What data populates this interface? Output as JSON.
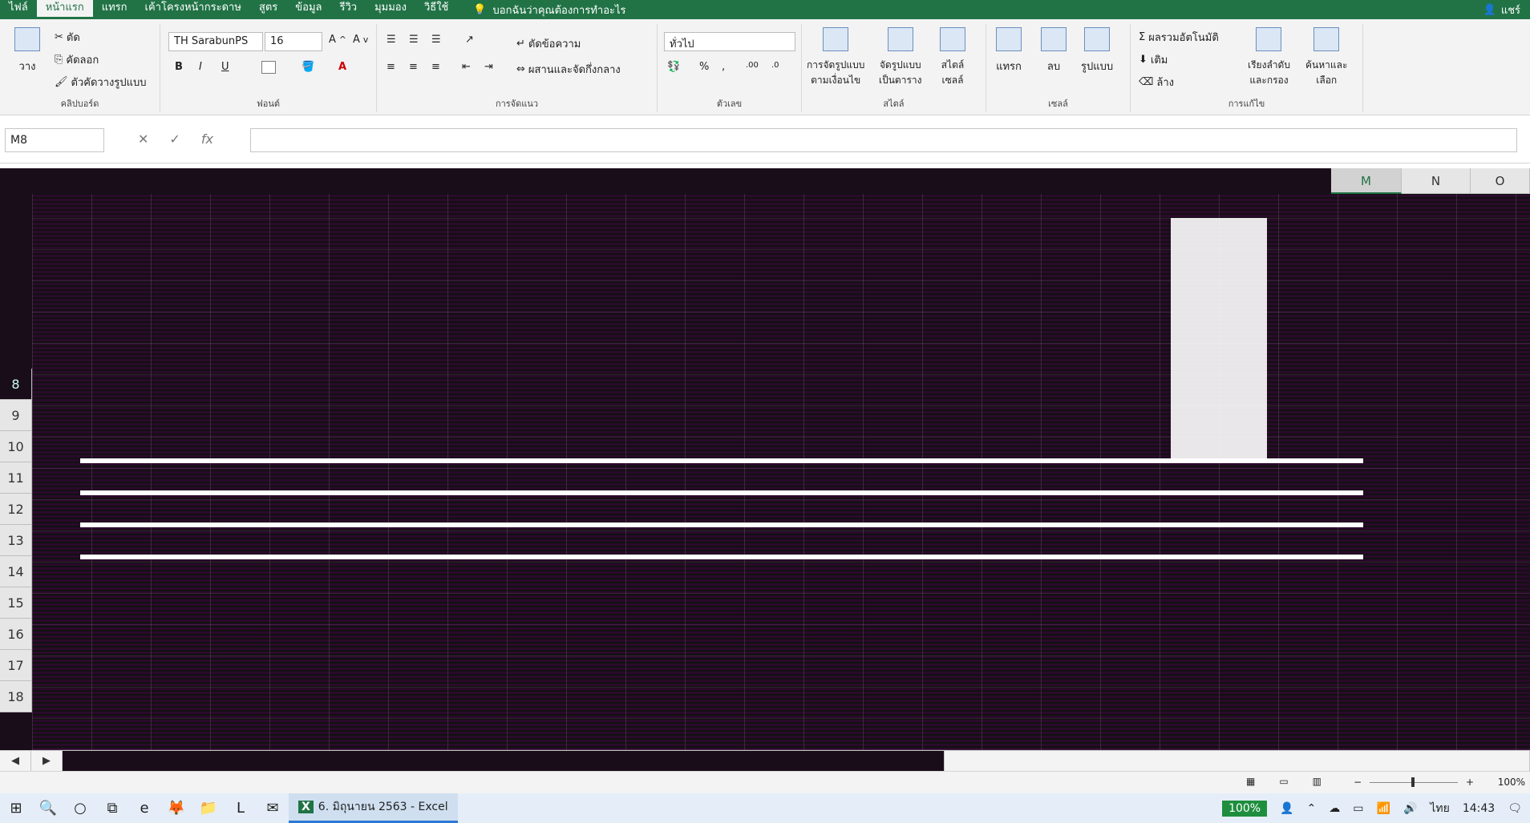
{
  "ribbon_tabs": [
    "ไฟล์",
    "หน้าแรก",
    "แทรก",
    "เค้าโครงหน้ากระดาษ",
    "สูตร",
    "ข้อมูล",
    "รีวิว",
    "มุมมอง",
    "วิธีใช้"
  ],
  "active_tab": "หน้าแรก",
  "tell_me": "บอกฉันว่าคุณต้องการทำอะไร",
  "share_label": "แชร์",
  "clipboard": {
    "paste": "วาง",
    "cut": "ตัด",
    "copy": "คัดลอก",
    "format_painter": "ตัวคัดวางรูปแบบ",
    "label": "คลิปบอร์ด"
  },
  "font": {
    "name": "TH SarabunPS",
    "size": "16",
    "label": "ฟอนต์"
  },
  "alignment": {
    "wrap": "ตัดข้อความ",
    "merge": "ผสานและจัดกึ่งกลาง",
    "label": "การจัดแนว"
  },
  "number": {
    "format": "ทั่วไป",
    "label": "ตัวเลข"
  },
  "styles": {
    "cond": "การจัดรูปแบบ\nตามเงื่อนไข",
    "table": "จัดรูปแบบ\nเป็นตาราง",
    "cell": "สไตล์\nเซลล์",
    "label": "สไตล์"
  },
  "cells_group": {
    "insert": "แทรก",
    "delete": "ลบ",
    "format": "รูปแบบ",
    "label": "เซลล์"
  },
  "editing": {
    "autosum": "ผลรวมอัตโนมัติ",
    "fill": "เติม",
    "clear": "ล้าง",
    "sort": "เรียงลำดับ\nและกรอง",
    "find": "ค้นหาและ\nเลือก",
    "label": "การแก้ไข"
  },
  "name_box": "M8",
  "columns": [
    "M",
    "N",
    "O"
  ],
  "selected_column": "M",
  "rows": [
    "8",
    "9",
    "10",
    "11",
    "12",
    "13",
    "14",
    "15",
    "16",
    "17",
    "18"
  ],
  "zoom": "100%",
  "taskbar": {
    "app_title": "6. มิถุนายน 2563 - Excel",
    "battery": "100%",
    "lang": "ไทย",
    "time": "14:43"
  }
}
